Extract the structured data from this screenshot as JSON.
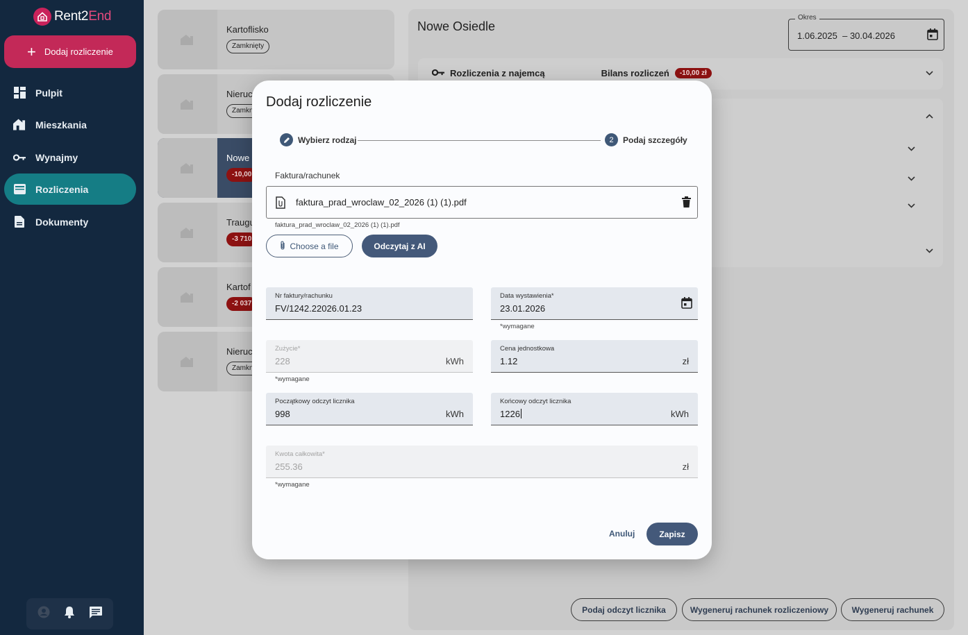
{
  "app": {
    "logo_prefix": "Rent2",
    "logo_suffix": "End"
  },
  "sidebar": {
    "add_label": "Dodaj rozliczenie",
    "items": [
      {
        "label": "Pulpit",
        "icon": "dashboard-icon"
      },
      {
        "label": "Mieszkania",
        "icon": "home-icon"
      },
      {
        "label": "Wynajmy",
        "icon": "key-icon"
      },
      {
        "label": "Rozliczenia",
        "icon": "wallet-icon",
        "active": true
      },
      {
        "label": "Dokumenty",
        "icon": "document-icon"
      }
    ]
  },
  "list": [
    {
      "name": "Kartoflisko",
      "chip": "Zamknięty",
      "chip_type": "outline"
    },
    {
      "name": "Nieruc",
      "chip": "Zamkn",
      "chip_type": "outline"
    },
    {
      "name": "Nowe",
      "chip": "-10,00",
      "chip_type": "red",
      "selected": true
    },
    {
      "name": "Traugu",
      "chip": "-3 710",
      "chip_type": "red"
    },
    {
      "name": "Kartof",
      "chip": "-2 037",
      "chip_type": "red"
    },
    {
      "name": "Nieruc",
      "chip": "Zamkn",
      "chip_type": "outline"
    }
  ],
  "detail": {
    "title": "Nowe Osiedle",
    "period_label": "Okres",
    "period_start": "1.06.2025",
    "period_sep": "–",
    "period_end": "30.04.2026",
    "tenant_section": "Rozliczenia z najemcą",
    "balance_label": "Bilans rozliczeń",
    "balance_value": "-10,00 zł",
    "buttons": {
      "meter": "Podaj odczyt licznika",
      "settlement_bill": "Wygeneruj rachunek rozliczeniowy",
      "bill": "Wygeneruj rachunek"
    }
  },
  "modal": {
    "title": "Dodaj rozliczenie",
    "step1": "Wybierz rodzaj",
    "step2_number": "2",
    "step2": "Podaj szczegóły",
    "file_label": "Faktura/rachunek",
    "file_name": "faktura_prad_wroclaw_02_2026 (1) (1).pdf",
    "file_hint": "faktura_prad_wroclaw_02_2026 (1) (1).pdf",
    "choose_file": "Choose a file",
    "read_ai": "Odczytaj z AI",
    "invoice_no_label": "Nr faktury/rachunku",
    "invoice_no": "FV/1242.22026.01.23",
    "issue_date_label": "Data wystawienia*",
    "issue_date": "23.01.2026",
    "required": "*wymagane",
    "usage_label": "Zużycie*",
    "usage": "228",
    "unit_kwh": "kWh",
    "unit_price_label": "Cena jednostkowa",
    "unit_price": "1.12",
    "unit_zl": "zł",
    "start_reading_label": "Początkowy odczyt licznika",
    "start_reading": "998",
    "end_reading_label": "Końcowy odczyt licznika",
    "end_reading": "1226",
    "total_label": "Kwota całkowita*",
    "total": "255.36",
    "cancel": "Anuluj",
    "save": "Zapisz"
  },
  "colors": {
    "sidebar_bg": "#13283f",
    "accent_pink": "#c32958",
    "active_teal": "#157d85",
    "primary_button": "#44597a",
    "negative_chip": "#8e1212"
  }
}
